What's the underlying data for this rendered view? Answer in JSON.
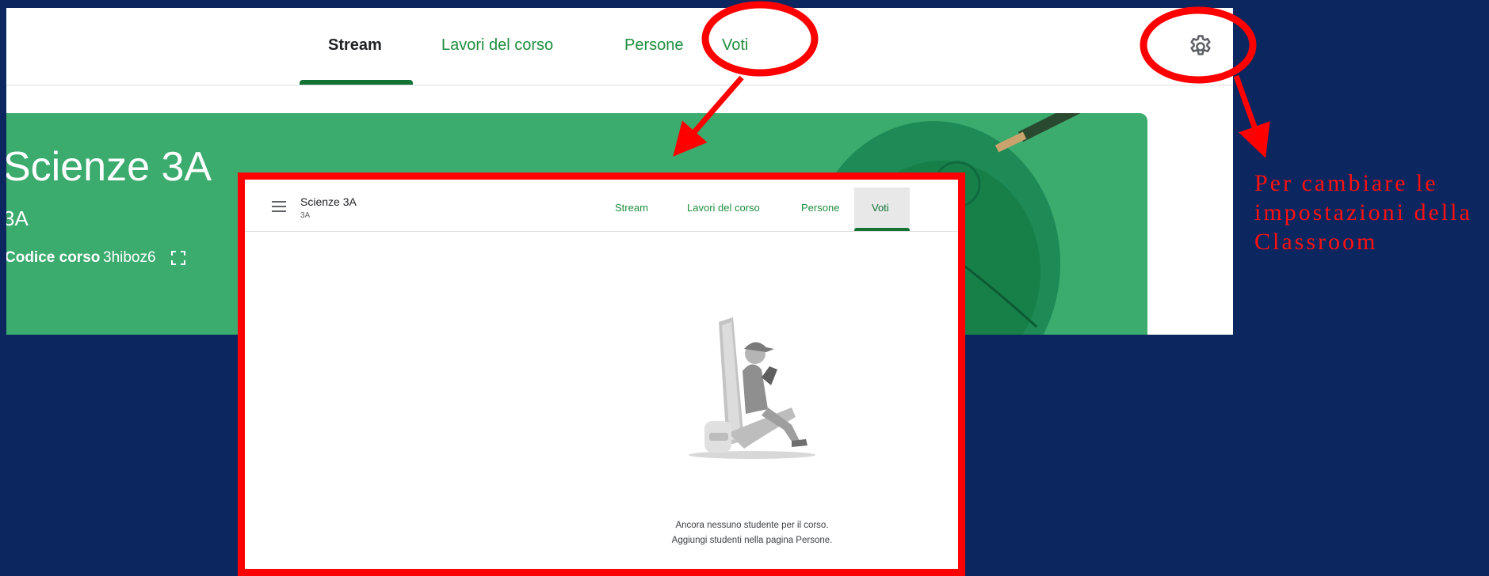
{
  "background_screenshot": {
    "tabs": [
      "Stream",
      "Lavori del corso",
      "Persone",
      "Voti"
    ],
    "active_tab": "Stream",
    "banner": {
      "title": "Scienze 3A",
      "section": "3A",
      "code_label": "Codice corso",
      "code_value": "3hiboz6"
    },
    "icons": [
      "gear-icon",
      "fullscreen-icon"
    ]
  },
  "front_screenshot": {
    "class_title": "Scienze 3A",
    "class_section": "3A",
    "tabs": [
      "Stream",
      "Lavori del corso",
      "Persone",
      "Voti"
    ],
    "active_tab": "Voti",
    "empty_state": {
      "line1": "Ancora nessuno studente per il corso.",
      "line2": "Aggiungi studenti nella pagina Persone."
    },
    "icons": [
      "menu-icon"
    ]
  },
  "annotation": {
    "settings_note": "Per cambiare le impostazioni della Classroom",
    "color": "#ff0000"
  },
  "colors": {
    "slide_background": "#0c2660",
    "banner_green": "#3bab6e",
    "tab_green": "#1e8e3e"
  }
}
